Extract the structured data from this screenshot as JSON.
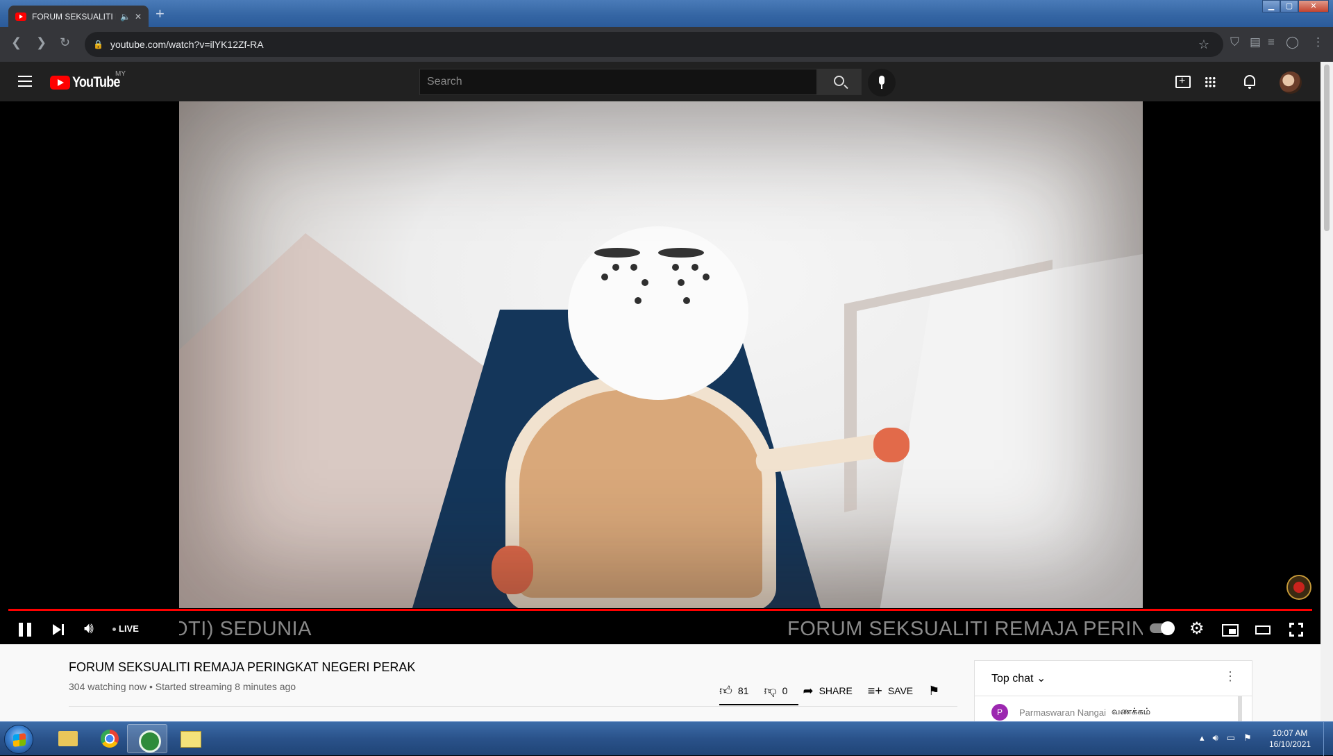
{
  "browser": {
    "tab_title": "FORUM SEKSUALITI RE",
    "url": "youtube.com/watch?v=ilYK12Zf-RA",
    "colors": {
      "titlebar": "#3566a4",
      "toolbar": "#35363a"
    }
  },
  "youtube": {
    "logo_text": "YouTube",
    "region": "MY",
    "search_placeholder": "Search",
    "accent": "#ff0000"
  },
  "player": {
    "ticker_left": "OTI) SEDUNIA",
    "ticker_right": "FORUM SEKSUALITI REMAJA PERING",
    "live_label": "LIVE",
    "progress_fraction": 1.0
  },
  "video": {
    "title": "FORUM SEKSUALITI REMAJA PERINGKAT NEGERI PERAK",
    "meta": "304 watching now • Started streaming 8 minutes ago",
    "likes": "81",
    "dislikes": "0",
    "share_label": "SHARE",
    "save_label": "SAVE"
  },
  "chat": {
    "header": "Top chat",
    "messages": [
      {
        "avatar_letter": "P",
        "author": "Parmaswaran Nangai",
        "text": "வணக்கம்"
      }
    ]
  },
  "taskbar": {
    "time": "10:07 AM",
    "date": "16/10/2021"
  }
}
